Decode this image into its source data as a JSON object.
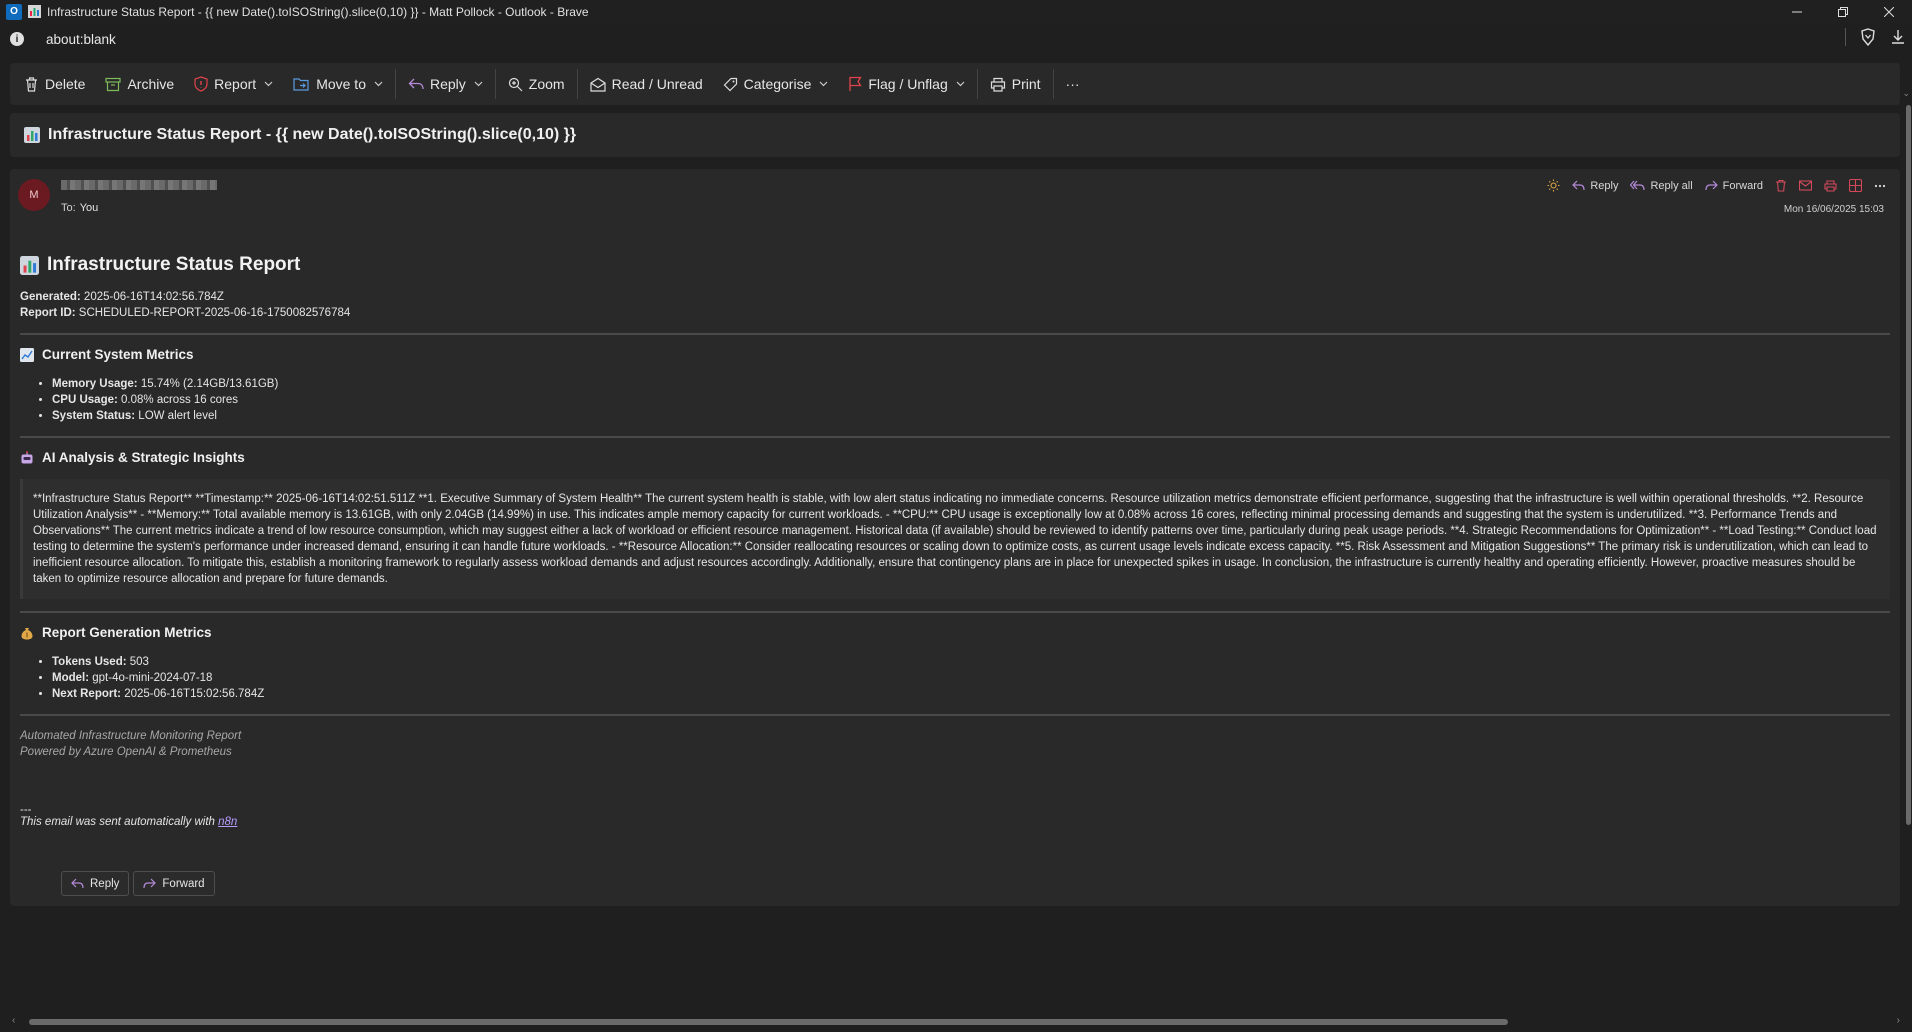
{
  "window": {
    "title": "Infrastructure Status Report - {{ new Date().toISOString().slice(0,10) }} - Matt Pollock - Outlook - Brave",
    "app_icon_letter": "O"
  },
  "address": {
    "url": "about:blank"
  },
  "toolbar": {
    "delete": "Delete",
    "archive": "Archive",
    "report": "Report",
    "move_to": "Move to",
    "reply": "Reply",
    "zoom": "Zoom",
    "read_unread": "Read / Unread",
    "categorise": "Categorise",
    "flag_unflag": "Flag / Unflag",
    "print": "Print",
    "more": "···"
  },
  "subject": "Infrastructure Status Report - {{ new Date().toISOString().slice(0,10) }}",
  "message": {
    "avatar_initial": "M",
    "to_label": "To:",
    "to_value": "You",
    "actions": {
      "reply": "Reply",
      "reply_all": "Reply all",
      "forward": "Forward"
    },
    "date": "Mon 16/06/2025 15:03"
  },
  "report": {
    "title": "Infrastructure Status Report",
    "generated_label": "Generated:",
    "generated_value": "2025-06-16T14:02:56.784Z",
    "report_id_label": "Report ID:",
    "report_id_value": "SCHEDULED-REPORT-2025-06-16-1750082576784",
    "metrics_heading": "Current System Metrics",
    "metrics": [
      {
        "label": "Memory Usage:",
        "value": "15.74% (2.14GB/13.61GB)"
      },
      {
        "label": "CPU Usage:",
        "value": "0.08% across 16 cores"
      },
      {
        "label": "System Status:",
        "value": "LOW alert level"
      }
    ],
    "ai_heading": "AI Analysis & Strategic Insights",
    "ai_text": "**Infrastructure Status Report** **Timestamp:** 2025-06-16T14:02:51.511Z **1. Executive Summary of System Health** The current system health is stable, with low alert status indicating no immediate concerns. Resource utilization metrics demonstrate efficient performance, suggesting that the infrastructure is well within operational thresholds. **2. Resource Utilization Analysis** - **Memory:** Total available memory is 13.61GB, with only 2.04GB (14.99%) in use. This indicates ample memory capacity for current workloads. - **CPU:** CPU usage is exceptionally low at 0.08% across 16 cores, reflecting minimal processing demands and suggesting that the system is underutilized. **3. Performance Trends and Observations** The current metrics indicate a trend of low resource consumption, which may suggest either a lack of workload or efficient resource management. Historical data (if available) should be reviewed to identify patterns over time, particularly during peak usage periods. **4. Strategic Recommendations for Optimization** - **Load Testing:** Conduct load testing to determine the system's performance under increased demand, ensuring it can handle future workloads. - **Resource Allocation:** Consider reallocating resources or scaling down to optimize costs, as current usage levels indicate excess capacity. **5. Risk Assessment and Mitigation Suggestions** The primary risk is underutilization, which can lead to inefficient resource allocation. To mitigate this, establish a monitoring framework to regularly assess workload demands and adjust resources accordingly. Additionally, ensure that contingency plans are in place for unexpected spikes in usage. In conclusion, the infrastructure is currently healthy and operating efficiently. However, proactive measures should be taken to optimize resource allocation and prepare for future demands.",
    "gen_heading": "Report Generation Metrics",
    "gen_metrics": [
      {
        "label": "Tokens Used:",
        "value": "503"
      },
      {
        "label": "Model:",
        "value": "gpt-4o-mini-2024-07-18"
      },
      {
        "label": "Next Report:",
        "value": "2025-06-16T15:02:56.784Z"
      }
    ],
    "footer_line1": "Automated Infrastructure Monitoring Report",
    "footer_line2": "Powered by Azure OpenAI & Prometheus",
    "sig_dashes": "---",
    "sig_text": "This email was sent automatically with",
    "sig_link": "n8n"
  },
  "bottom_buttons": {
    "reply": "Reply",
    "forward": "Forward"
  },
  "colors": {
    "accent_flag": "#e0434b",
    "link": "#b69cff",
    "avatar_bg": "#6b1a22",
    "delete_red": "#d24a5a"
  }
}
